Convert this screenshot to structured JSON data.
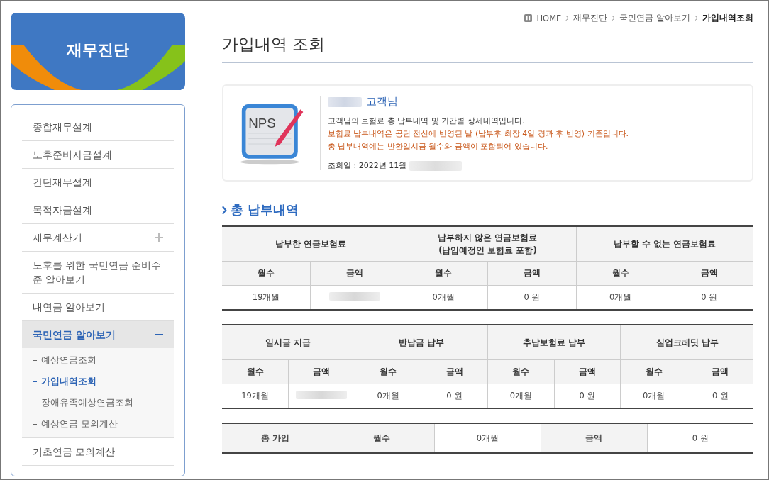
{
  "banner": {
    "title": "재무진단"
  },
  "menu": [
    {
      "label": "종합재무설계",
      "kind": "item",
      "selected": false
    },
    {
      "label": "노후준비자금설계",
      "kind": "item",
      "selected": false
    },
    {
      "label": "간단재무설계",
      "kind": "item",
      "selected": false
    },
    {
      "label": "목적자금설계",
      "kind": "item",
      "selected": false
    },
    {
      "label": "재무계산기",
      "kind": "group",
      "selected": false,
      "expanded": false
    },
    {
      "label": "노후를 위한 국민연금 준비수준 알아보기",
      "kind": "item",
      "selected": false
    },
    {
      "label": "내연금 알아보기",
      "kind": "item",
      "selected": false
    },
    {
      "label": "국민연금 알아보기",
      "kind": "group",
      "selected": true,
      "expanded": true,
      "children": [
        {
          "label": "예상연금조회",
          "selected": false
        },
        {
          "label": "가입내역조회",
          "selected": true
        },
        {
          "label": "장애유족예상연금조회",
          "selected": false
        },
        {
          "label": "예상연금 모의계산",
          "selected": false
        }
      ]
    },
    {
      "label": "기초연금 모의계산",
      "kind": "item",
      "selected": false
    }
  ],
  "breadcrumb": [
    "HOME",
    "재무진단",
    "국민연금 알아보기",
    "가입내역조회"
  ],
  "page_title": "가입내역 조회",
  "info": {
    "icon_label": "NPS",
    "customer_suffix": "고객님",
    "lines": [
      {
        "text": "고객님의 보험료 총 납부내역 및 기간별 상세내역입니다.",
        "kind": "normal"
      },
      {
        "text": "보험료 납부내역은 공단 전산에 반영된 날 (납부후 최장 4일 경과 후 반영) 기준입니다.",
        "kind": "notice"
      },
      {
        "text": "총 납부내역에는 반환일시금 월수와 금액이 포함되어 있습니다.",
        "kind": "notice"
      }
    ],
    "query_date": "조회일 : 2022년 11월"
  },
  "section_title": "총 납부내역",
  "tables": [
    {
      "groups": [
        {
          "label": "납부한 연금보험료"
        },
        {
          "label": "납부하지 않은 연금보험료\n(납입예정인 보험료 포함)"
        },
        {
          "label": "납부할 수 없는 연금보험료"
        }
      ],
      "subheads": [
        "월수",
        "금액",
        "월수",
        "금액",
        "월수",
        "금액"
      ],
      "cells": [
        {
          "text": "19개월"
        },
        {
          "redacted": true
        },
        {
          "text": "0개월"
        },
        {
          "text": "0 원"
        },
        {
          "text": "0개월"
        },
        {
          "text": "0 원"
        }
      ]
    },
    {
      "groups": [
        {
          "label": "일시금 지급"
        },
        {
          "label": "반납금 납부"
        },
        {
          "label": "추납보험료 납부"
        },
        {
          "label": "실업크레딧 납부"
        }
      ],
      "subheads": [
        "월수",
        "금액",
        "월수",
        "금액",
        "월수",
        "금액",
        "월수",
        "금액"
      ],
      "cells": [
        {
          "text": "19개월"
        },
        {
          "redacted": true
        },
        {
          "text": "0개월"
        },
        {
          "text": "0 원"
        },
        {
          "text": "0개월"
        },
        {
          "text": "0 원"
        },
        {
          "text": "0개월"
        },
        {
          "text": "0 원"
        }
      ]
    }
  ],
  "total": [
    {
      "text": "총 가입",
      "kind": "head"
    },
    {
      "text": "월수",
      "kind": "head"
    },
    {
      "text": "0개월",
      "kind": "value"
    },
    {
      "text": "금액",
      "kind": "head"
    },
    {
      "text": "0 원",
      "kind": "value"
    }
  ]
}
